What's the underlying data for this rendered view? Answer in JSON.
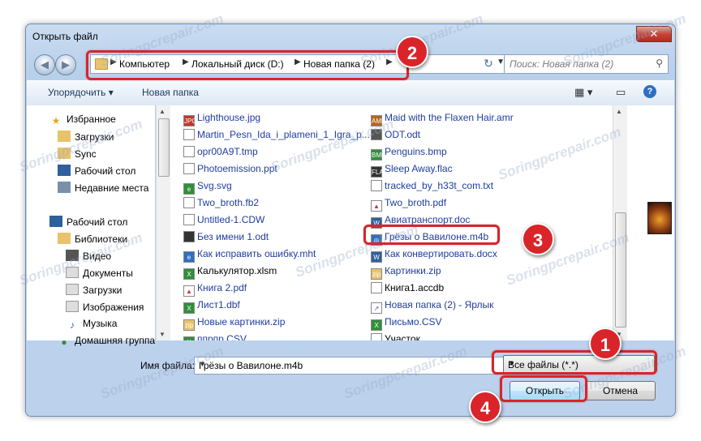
{
  "window": {
    "title": "Открыть файл",
    "close_label": "✕"
  },
  "address": {
    "crumbs": [
      "Компьютер",
      "Локальный диск (D:)",
      "Новая папка (2)"
    ],
    "search_placeholder": "Поиск: Новая папка (2)"
  },
  "toolbar": {
    "organize": "Упорядочить ▾",
    "new_folder": "Новая папка"
  },
  "nav": {
    "favorites": "Избранное",
    "fav_items": [
      "Загрузки",
      "Sync",
      "Рабочий стол",
      "Недавние места"
    ],
    "desktop": "Рабочий стол",
    "libraries": "Библиотеки",
    "lib_items": [
      "Видео",
      "Документы",
      "Загрузки",
      "Изображения",
      "Музыка"
    ],
    "homegroup": "Домашняя группа"
  },
  "files_col1": [
    "Lighthouse.jpg",
    "Martin_Pesn_Ida_i_plameni_1_Igra_p...",
    "opr00A9T.tmp",
    "Photoemission.ppt",
    "Svg.svg",
    "Two_broth.fb2",
    "Untitled-1.CDW",
    "Без имени 1.odt",
    "Как исправить ошибку.mht",
    "Калькулятор.xlsm",
    "Книга 2.pdf",
    "Лист1.dbf",
    "Новые картинки.zip",
    "ппрпр.CSV"
  ],
  "files_col2": [
    "Maid with the Flaxen Hair.amr",
    "ODT.odt",
    "Penguins.bmp",
    "Sleep Away.flac",
    "tracked_by_h33t_com.txt",
    "Two_broth.pdf",
    "Авиатранспорт.doc",
    "Грёзы о Вавилоне.m4b",
    "Как конвертировать.docx",
    "Картинки.zip",
    "Книга1.accdb",
    "Новая папка (2) - Ярлык",
    "Письмо.CSV",
    "Участок"
  ],
  "bottom": {
    "filename_label": "Имя файла:",
    "filename_value": "Грёзы о Вавилоне.m4b",
    "filetype_value": "Все файлы (*.*)",
    "open_label": "Открыть",
    "cancel_label": "Отмена"
  },
  "badges": [
    "1",
    "2",
    "3",
    "4"
  ],
  "watermark": "Soringpcrepair.com",
  "colors": {
    "highlight": "#d9252a",
    "link": "#1f3d9c"
  }
}
